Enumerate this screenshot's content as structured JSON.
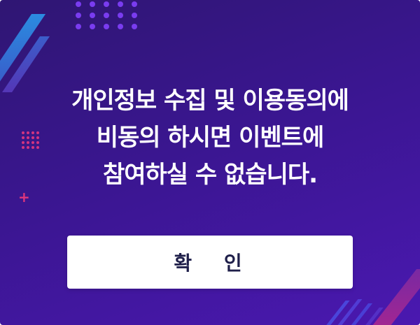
{
  "dialog": {
    "message_lines": [
      "개인정보 수집 및 이용동의에",
      "비동의 하시면 이벤트에",
      "참여하실 수 없습니다."
    ],
    "confirm_label": "확 인"
  },
  "colors": {
    "background_start": "#2f1673",
    "background_end": "#4a18b0",
    "accent_purple": "#7a3cf0",
    "accent_pink": "#e0367c",
    "accent_blue": "#2b8be0",
    "button_bg": "#ffffff",
    "button_text": "#1f1f4a"
  }
}
